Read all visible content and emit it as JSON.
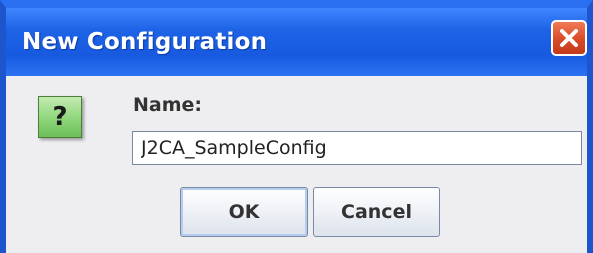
{
  "dialog": {
    "title": "New Configuration",
    "icon_name": "question-icon",
    "icon_glyph": "?",
    "name_label": "Name:",
    "name_value": "J2CA_SampleConfig",
    "ok_label": "OK",
    "cancel_label": "Cancel"
  },
  "titlebar": {
    "close_icon": "close-icon"
  },
  "colors": {
    "title_bar": "#1e63e6",
    "close_button": "#d94a27",
    "dialog_background": "#eeeef0",
    "icon_green": "#8ed57a"
  }
}
